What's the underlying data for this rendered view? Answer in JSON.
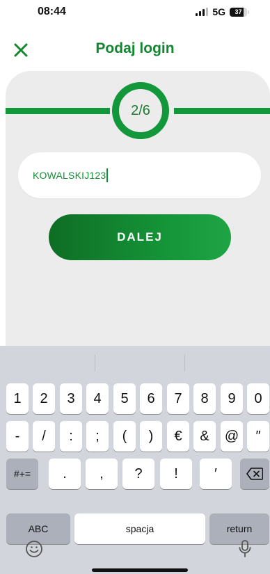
{
  "status_bar": {
    "time": "08:44",
    "network": "5G",
    "battery": "37"
  },
  "header": {
    "title": "Podaj login",
    "close_icon": "close-icon"
  },
  "progress": {
    "step_label": "2/6",
    "current_step": 2,
    "total_steps": 6
  },
  "login_field": {
    "value": "KOWALSKIJ123"
  },
  "next_button": {
    "label": "DALEJ"
  },
  "keyboard": {
    "row1": [
      "1",
      "2",
      "3",
      "4",
      "5",
      "6",
      "7",
      "8",
      "9",
      "0"
    ],
    "row2": [
      "-",
      "/",
      ":",
      ";",
      "(",
      ")",
      "€",
      "&",
      "@",
      "″"
    ],
    "row3_left": "#+=",
    "row3": [
      ".",
      ",",
      "?",
      "!",
      "′"
    ],
    "row3_right": "backspace-icon",
    "abc": "ABC",
    "space": "spacja",
    "return": "return",
    "emoji": "emoji-icon",
    "mic": "microphone-icon"
  },
  "colors": {
    "brand_green": "#13872f",
    "card_background": "#ececec",
    "keyboard_background": "#d2d5db"
  }
}
